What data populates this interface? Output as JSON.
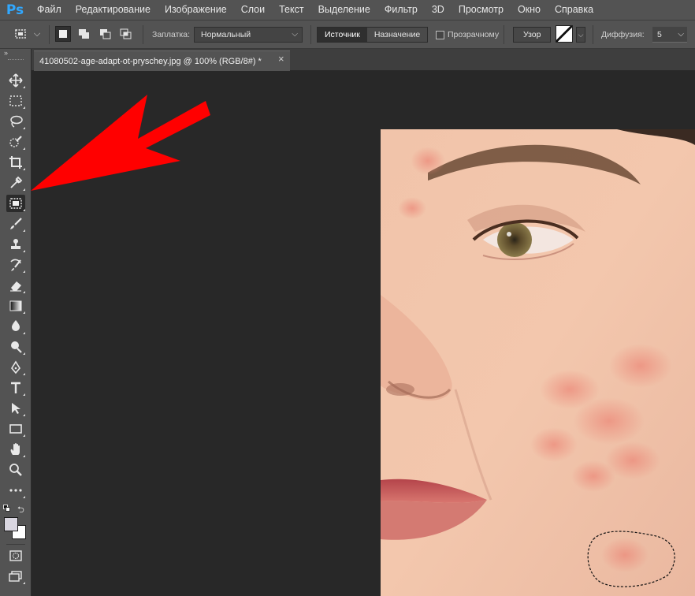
{
  "app": {
    "logo": "Ps"
  },
  "menu": [
    "Файл",
    "Редактирование",
    "Изображение",
    "Слои",
    "Текст",
    "Выделение",
    "Фильтр",
    "3D",
    "Просмотр",
    "Окно",
    "Справка"
  ],
  "options": {
    "patch_label": "Заплатка:",
    "patch_mode": "Нормальный",
    "source_label": "Источник",
    "destination_label": "Назначение",
    "transparent_label": "Прозрачному",
    "pattern_label": "Узор",
    "diffusion_label": "Диффузия:",
    "diffusion_value": "5"
  },
  "document": {
    "tab_title": "41080502-age-adapt-ot-pryschey.jpg @ 100% (RGB/8#) *",
    "close_glyph": "×"
  },
  "toolbar": {
    "collapse_glyph": "»",
    "active_tool": "patch-tool",
    "tools": [
      "move",
      "marquee",
      "lasso",
      "quick-selection",
      "crop",
      "eyedropper",
      "patch",
      "brush",
      "stamp",
      "history-brush",
      "eraser",
      "gradient",
      "blur",
      "dodge",
      "pen",
      "type",
      "path-selection",
      "rectangle",
      "hand",
      "zoom",
      "more"
    ]
  },
  "colors": {
    "foreground": "#d9d6e0",
    "background": "#ffffff",
    "annotation_arrow": "#ff0000",
    "ps_blue": "#31a8ff"
  }
}
